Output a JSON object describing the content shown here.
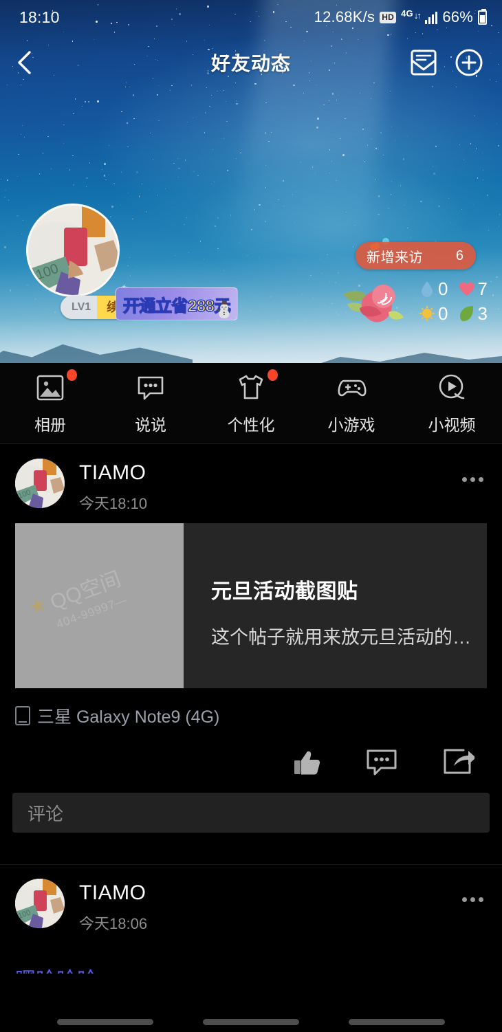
{
  "statusbar": {
    "time": "18:10",
    "net_speed": "12.68K/s",
    "hd_badge": "HD",
    "network": "4G",
    "battery_percent": "66%",
    "icons": [
      "hd-icon",
      "data-transfer-icon",
      "signal-bars-icon",
      "battery-icon"
    ]
  },
  "titlebar": {
    "title": "好友动态",
    "back_icon": "chevron-left-icon",
    "message_icon": "envelope-icon",
    "add_icon": "plus-circle-icon"
  },
  "cover": {
    "level_badge": "LV1",
    "renew_label": "续费",
    "promo_text": "开通立省288元",
    "visitors_label": "新增来访",
    "visitors_count": "6",
    "garden_stats": [
      {
        "icon": "water-drop-icon",
        "value": "0"
      },
      {
        "icon": "heart-icon",
        "value": "7"
      },
      {
        "icon": "sun-icon",
        "value": "0"
      },
      {
        "icon": "leaf-icon",
        "value": "3"
      }
    ]
  },
  "nav": {
    "items": [
      {
        "label": "相册",
        "icon": "photo-icon",
        "badge": true
      },
      {
        "label": "说说",
        "icon": "speech-bubble-icon",
        "badge": false
      },
      {
        "label": "个性化",
        "icon": "tshirt-icon",
        "badge": true
      },
      {
        "label": "小游戏",
        "icon": "gamepad-icon",
        "badge": false
      },
      {
        "label": "小视频",
        "icon": "play-circle-icon",
        "badge": false
      }
    ]
  },
  "feed": {
    "posts": [
      {
        "author": "TIAMO",
        "time": "今天18:10",
        "more_icon": "more-dots-icon",
        "card": {
          "title": "元旦活动截图贴",
          "description": "这个帖子就用来放元旦活动的截...",
          "watermark": "QQ空间",
          "watermark_sub": "404-99997—"
        },
        "device": "三星 Galaxy Note9 (4G)",
        "device_icon": "phone-icon",
        "actions": [
          {
            "name": "like",
            "icon": "thumbs-up-icon"
          },
          {
            "name": "comment",
            "icon": "comment-bubble-icon"
          },
          {
            "name": "share",
            "icon": "share-arrow-icon"
          }
        ],
        "comment_placeholder": "评论"
      },
      {
        "author": "TIAMO",
        "time": "今天18:06",
        "more_icon": "more-dots-icon",
        "text_preview": "嘿哈哈哈"
      }
    ]
  },
  "colors": {
    "accent_red": "#f8452a",
    "visit_pill": "#e2583a",
    "cover_blue": "#14589f",
    "card_bg": "#262626",
    "link_blue": "#5a5ae0"
  }
}
